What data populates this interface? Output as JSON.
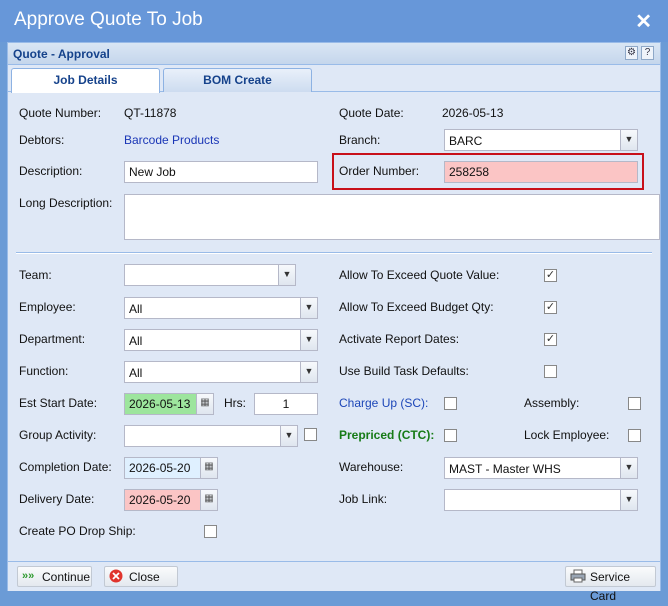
{
  "window": {
    "title": "Approve Quote To Job"
  },
  "panel": {
    "title": "Quote - Approval",
    "tool_settings": "⚙",
    "tool_help": "?"
  },
  "tabs": [
    {
      "label": "Job Details"
    },
    {
      "label": "BOM Create"
    }
  ],
  "form": {
    "quote_number_label": "Quote Number:",
    "quote_number": "QT-11878",
    "quote_date_label": "Quote Date:",
    "quote_date": "2026-05-13",
    "debtors_label": "Debtors:",
    "debtors": "Barcode Products",
    "branch_label": "Branch:",
    "branch": "BARC",
    "description_label": "Description:",
    "description": "New Job",
    "order_number_label": "Order Number:",
    "order_number": "258258",
    "long_description_label": "Long Description:",
    "long_description": "",
    "team_label": "Team:",
    "team": "",
    "employee_label": "Employee:",
    "employee": "All",
    "department_label": "Department:",
    "department": "All",
    "function_label": "Function:",
    "function": "All",
    "est_start_date_label": "Est Start Date:",
    "est_start_date": "2026-05-13",
    "hrs_label": "Hrs:",
    "hrs": "1",
    "group_activity_label": "Group Activity:",
    "group_activity": "",
    "completion_date_label": "Completion Date:",
    "completion_date": "2026-05-20",
    "delivery_date_label": "Delivery Date:",
    "delivery_date": "2026-05-20",
    "create_po_label": "Create PO Drop Ship:",
    "allow_exceed_quote_label": "Allow To Exceed Quote Value:",
    "allow_exceed_budget_label": "Allow To Exceed Budget Qty:",
    "activate_report_label": "Activate Report Dates:",
    "use_build_task_label": "Use Build Task Defaults:",
    "charge_up_label": "Charge Up (SC):",
    "assembly_label": "Assembly:",
    "prepriced_label": "Prepriced (CTC):",
    "lock_employee_label": "Lock Employee:",
    "warehouse_label": "Warehouse:",
    "warehouse": "MAST - Master WHS",
    "job_link_label": "Job Link:",
    "job_link": ""
  },
  "checks": {
    "allow_exceed_quote": true,
    "allow_exceed_budget": true,
    "activate_report": true,
    "use_build_task": false,
    "charge_up": false,
    "assembly": false,
    "prepriced": false,
    "lock_employee": false,
    "group_activity": false,
    "create_po": false
  },
  "footer": {
    "continue": "Continue",
    "close": "Close",
    "service_card": "Service Card"
  }
}
